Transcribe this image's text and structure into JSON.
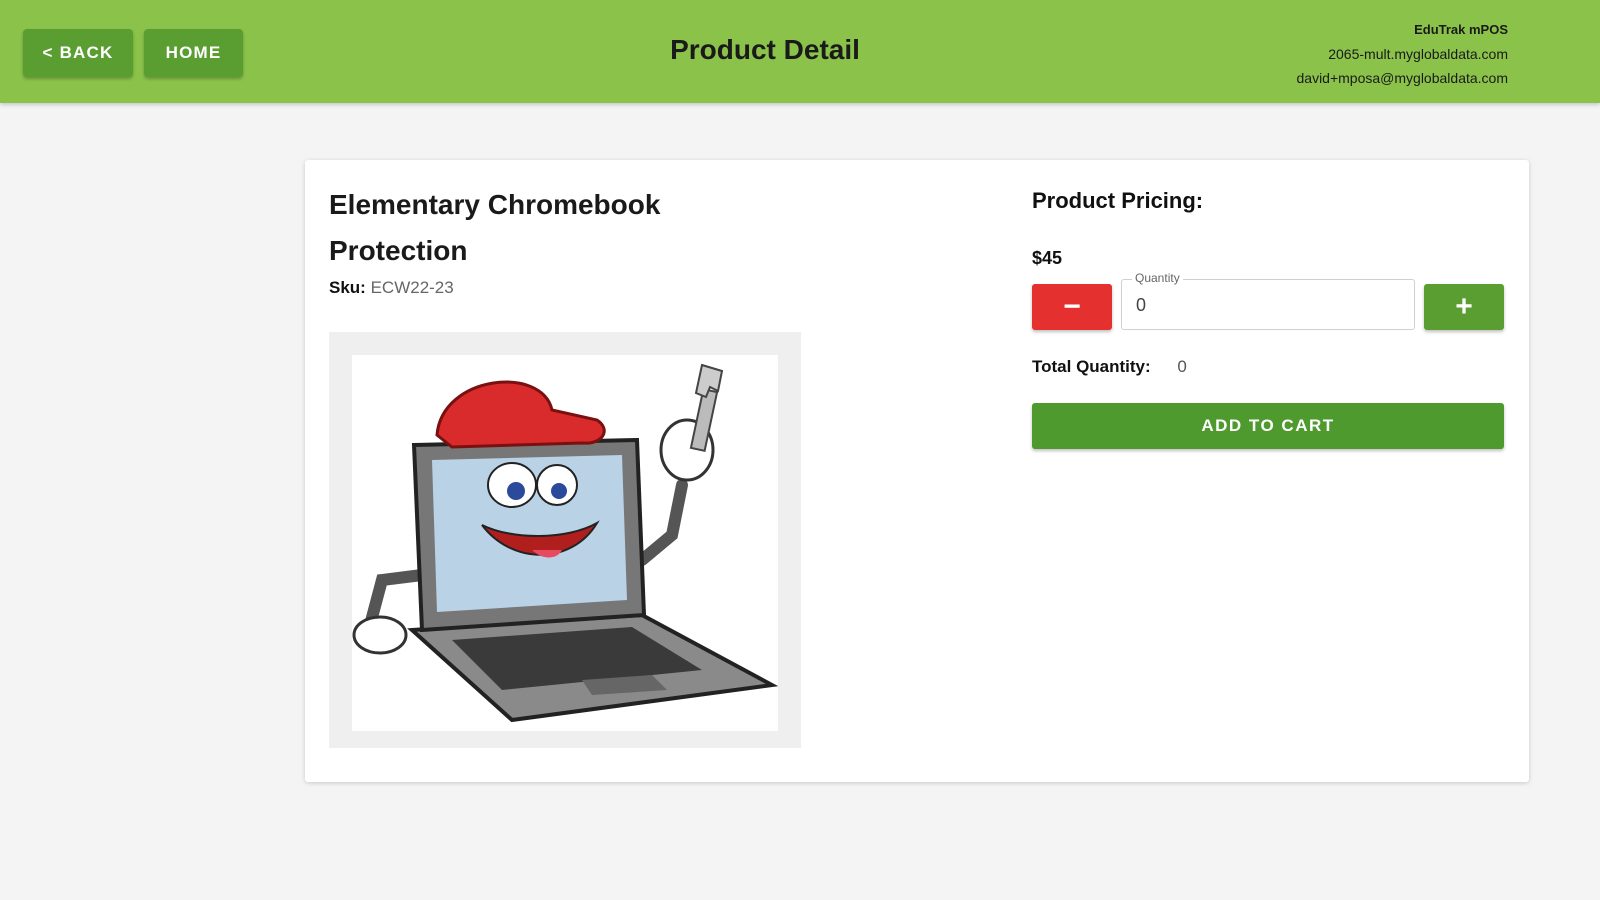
{
  "header": {
    "back_label": "< BACK",
    "home_label": "HOME",
    "title": "Product Detail",
    "app_name": "EduTrak mPOS",
    "domain": "2065-mult.myglobaldata.com",
    "email": "david+mposa@myglobaldata.com"
  },
  "product": {
    "name": "Elementary Chromebook Protection",
    "sku_label": "Sku:",
    "sku": "ECW22-23",
    "image_icon": "laptop-mascot-illustration"
  },
  "pricing": {
    "title": "Product Pricing:",
    "price": "$45",
    "minus_icon": "minus-icon",
    "plus_icon": "plus-icon",
    "quantity_label": "Quantity",
    "quantity_value": "0",
    "total_label": "Total Quantity:",
    "total_value": "0",
    "add_to_cart_label": "ADD TO CART"
  },
  "colors": {
    "header_bg": "#8bc34a",
    "green_button": "#5a9e32",
    "red_button": "#e53030"
  }
}
